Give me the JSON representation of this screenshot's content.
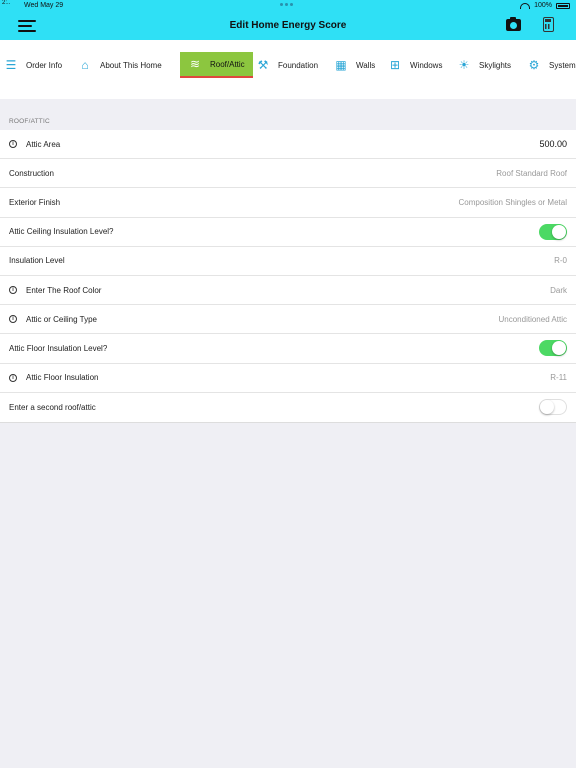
{
  "status": {
    "time": "Wed May 29",
    "corner": "2:..",
    "battery": "100%"
  },
  "header": {
    "title": "Edit Home Energy Score"
  },
  "colors": {
    "header_bg": "#2fe0f5",
    "active_tab": "#8cc63f",
    "active_underline": "#e0473f",
    "toggle_on": "#4cd964"
  },
  "tabs": [
    {
      "label": "Order Info",
      "icon": "list-icon"
    },
    {
      "label": "About This Home",
      "icon": "house-icon"
    },
    {
      "label": "Roof/Attic",
      "icon": "roof-icon",
      "active": true
    },
    {
      "label": "Foundation",
      "icon": "foundation-icon"
    },
    {
      "label": "Walls",
      "icon": "walls-icon"
    },
    {
      "label": "Windows",
      "icon": "window-icon"
    },
    {
      "label": "Skylights",
      "icon": "skylight-icon"
    },
    {
      "label": "Systems",
      "icon": "systems-icon"
    }
  ],
  "section": {
    "title": "ROOF/ATTIC"
  },
  "rows": [
    {
      "label": "Attic Area",
      "value": "500.00"
    },
    {
      "label": "Construction",
      "value": "Roof Standard Roof"
    },
    {
      "label": "Exterior Finish",
      "value": "Composition Shingles or Metal"
    },
    {
      "label": "Attic Ceiling Insulation Level?"
    },
    {
      "label": "Insulation Level",
      "value": "R-0"
    },
    {
      "label": "Enter The Roof Color",
      "value": "Dark"
    },
    {
      "label": "Attic or Ceiling Type",
      "value": "Unconditioned Attic"
    },
    {
      "label": "Attic Floor Insulation Level?"
    },
    {
      "label": "Attic Floor Insulation",
      "value": "R-11"
    },
    {
      "label": "Enter a second roof/attic"
    }
  ]
}
